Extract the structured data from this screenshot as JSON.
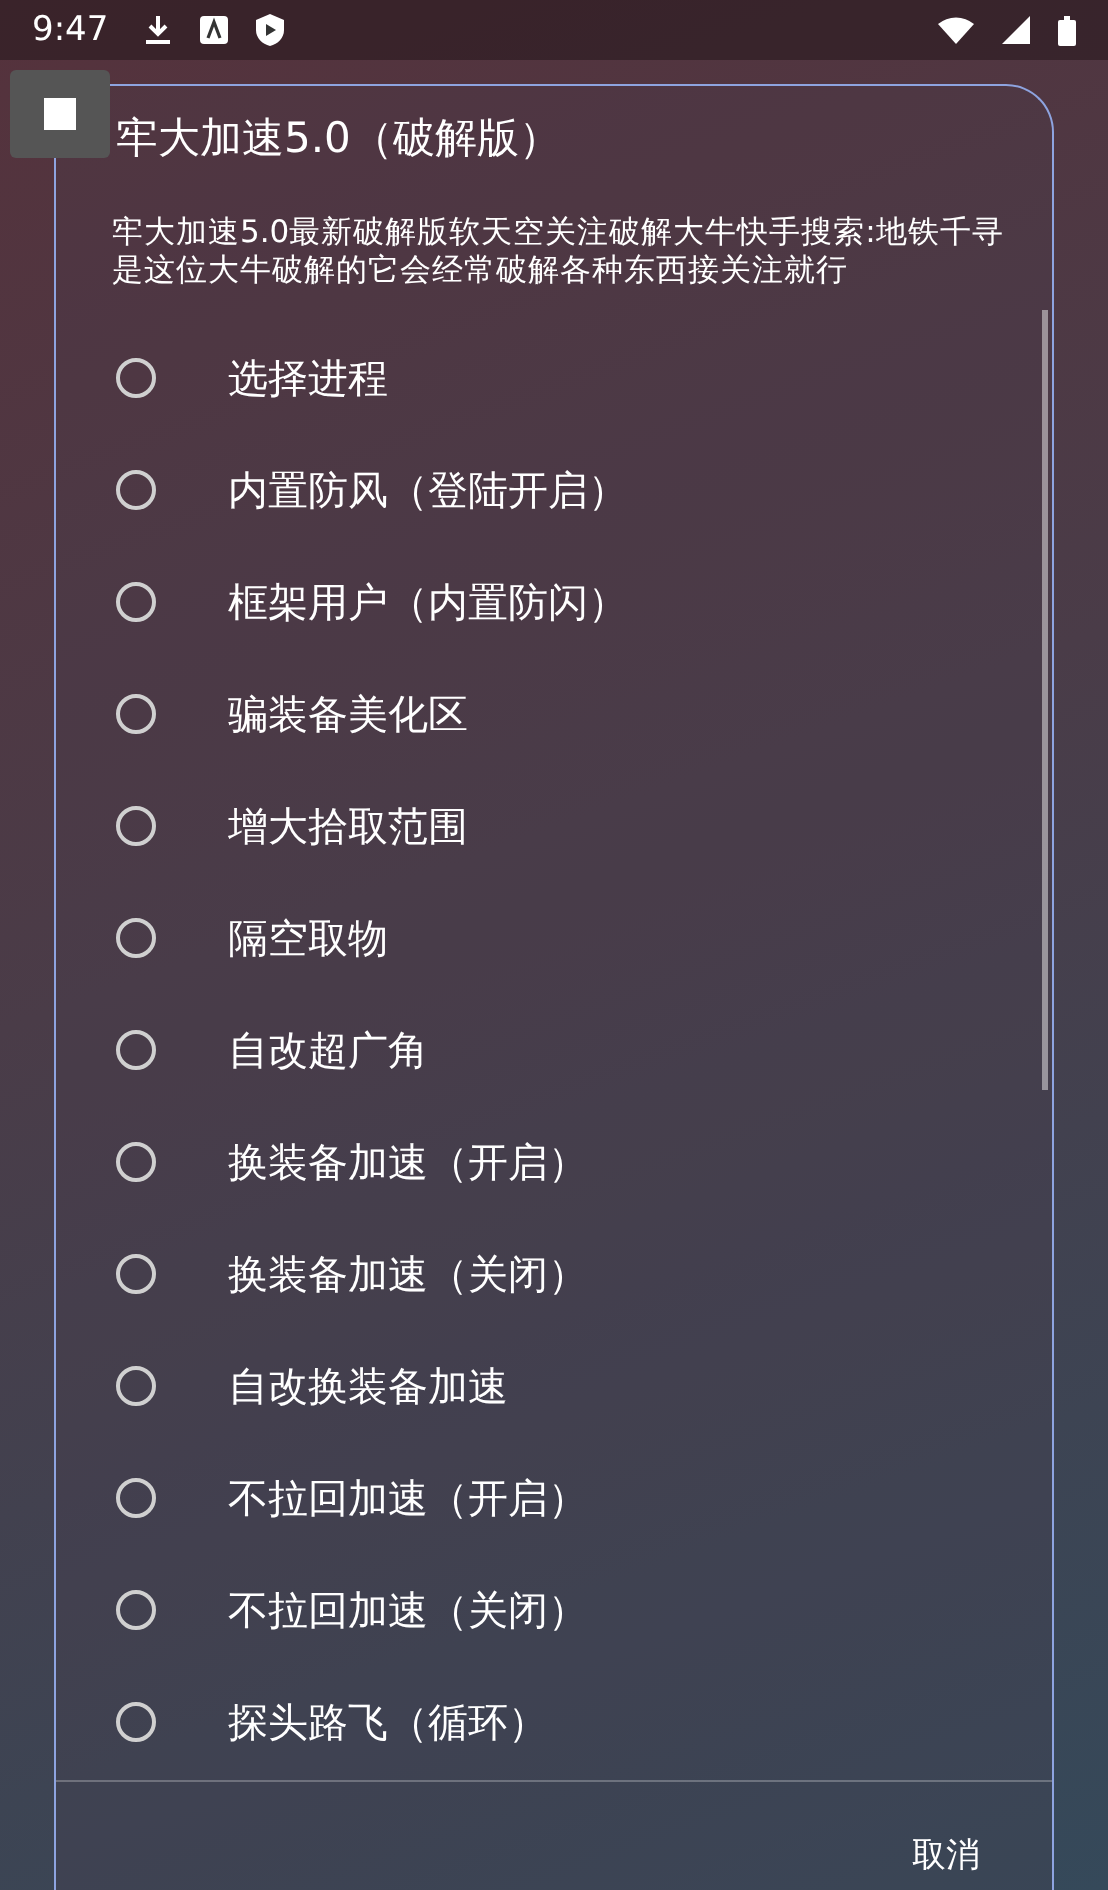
{
  "status_bar": {
    "time": "9:47"
  },
  "dialog": {
    "title": "牢大加速5.0（破解版）",
    "message": "牢大加速5.0最新破解版软天空关注破解大牛快手搜索:地铁千寻是这位大牛破解的它会经常破解各种东西接关注就行",
    "options": [
      {
        "label": "选择进程",
        "selected": false
      },
      {
        "label": "内置防风（登陆开启）",
        "selected": false
      },
      {
        "label": "框架用户（内置防闪）",
        "selected": false
      },
      {
        "label": "骗装备美化区",
        "selected": false
      },
      {
        "label": "增大拾取范围",
        "selected": false
      },
      {
        "label": "隔空取物",
        "selected": false
      },
      {
        "label": "自改超广角",
        "selected": false
      },
      {
        "label": "换装备加速（开启）",
        "selected": false
      },
      {
        "label": "换装备加速（关闭）",
        "selected": false
      },
      {
        "label": "自改换装备加速",
        "selected": false
      },
      {
        "label": "不拉回加速（开启）",
        "selected": false
      },
      {
        "label": "不拉回加速（关闭）",
        "selected": false
      },
      {
        "label": "探头路飞（循环）",
        "selected": false
      }
    ],
    "buttons": [
      "取消"
    ]
  }
}
